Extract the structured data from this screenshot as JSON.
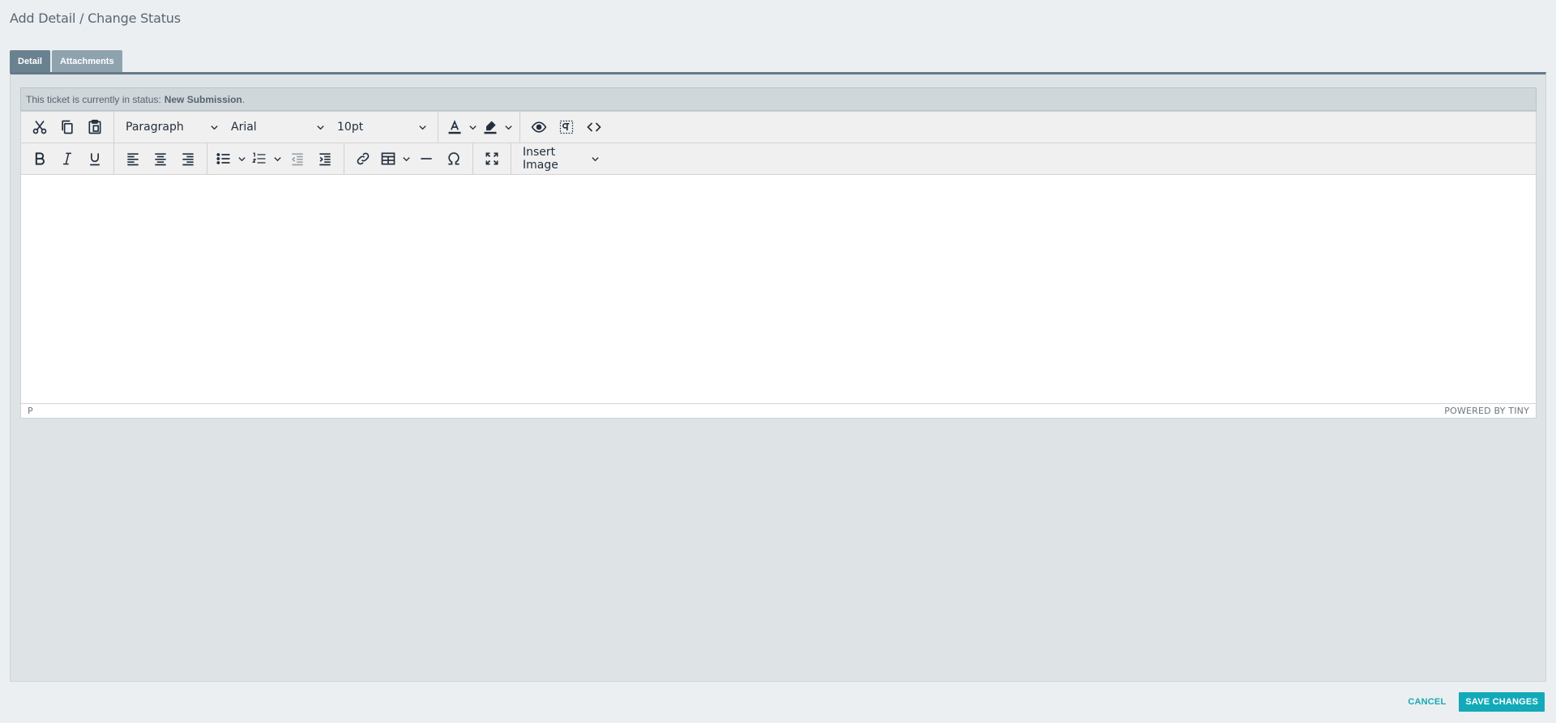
{
  "page": {
    "title": "Add Detail / Change Status"
  },
  "tabs": [
    {
      "label": "Detail",
      "active": true
    },
    {
      "label": "Attachments",
      "active": false
    }
  ],
  "status": {
    "prefix": "This ticket is currently in status:",
    "value": "New Submission",
    "suffix": "."
  },
  "toolbar": {
    "block_format": "Paragraph",
    "font_family": "Arial",
    "font_size": "10pt",
    "insert_image": "Insert Image",
    "icons": [
      "cut-icon",
      "copy-icon",
      "paste-icon",
      "text-color-icon",
      "highlight-icon",
      "preview-icon",
      "show-blocks-icon",
      "code-icon",
      "bold-icon",
      "italic-icon",
      "underline-icon",
      "align-left-icon",
      "align-center-icon",
      "align-right-icon",
      "bullet-list-icon",
      "numbered-list-icon",
      "outdent-icon",
      "indent-icon",
      "link-icon",
      "table-icon",
      "horizontal-rule-icon",
      "special-char-icon",
      "fullscreen-icon"
    ]
  },
  "editor": {
    "path": "P",
    "branding": "POWERED BY TINY"
  },
  "actions": {
    "cancel": "CANCEL",
    "save": "SAVE CHANGES"
  },
  "colors": {
    "accent": "#12aab8",
    "tab_active": "#6a8190",
    "tab_inactive": "#8fa3af"
  }
}
